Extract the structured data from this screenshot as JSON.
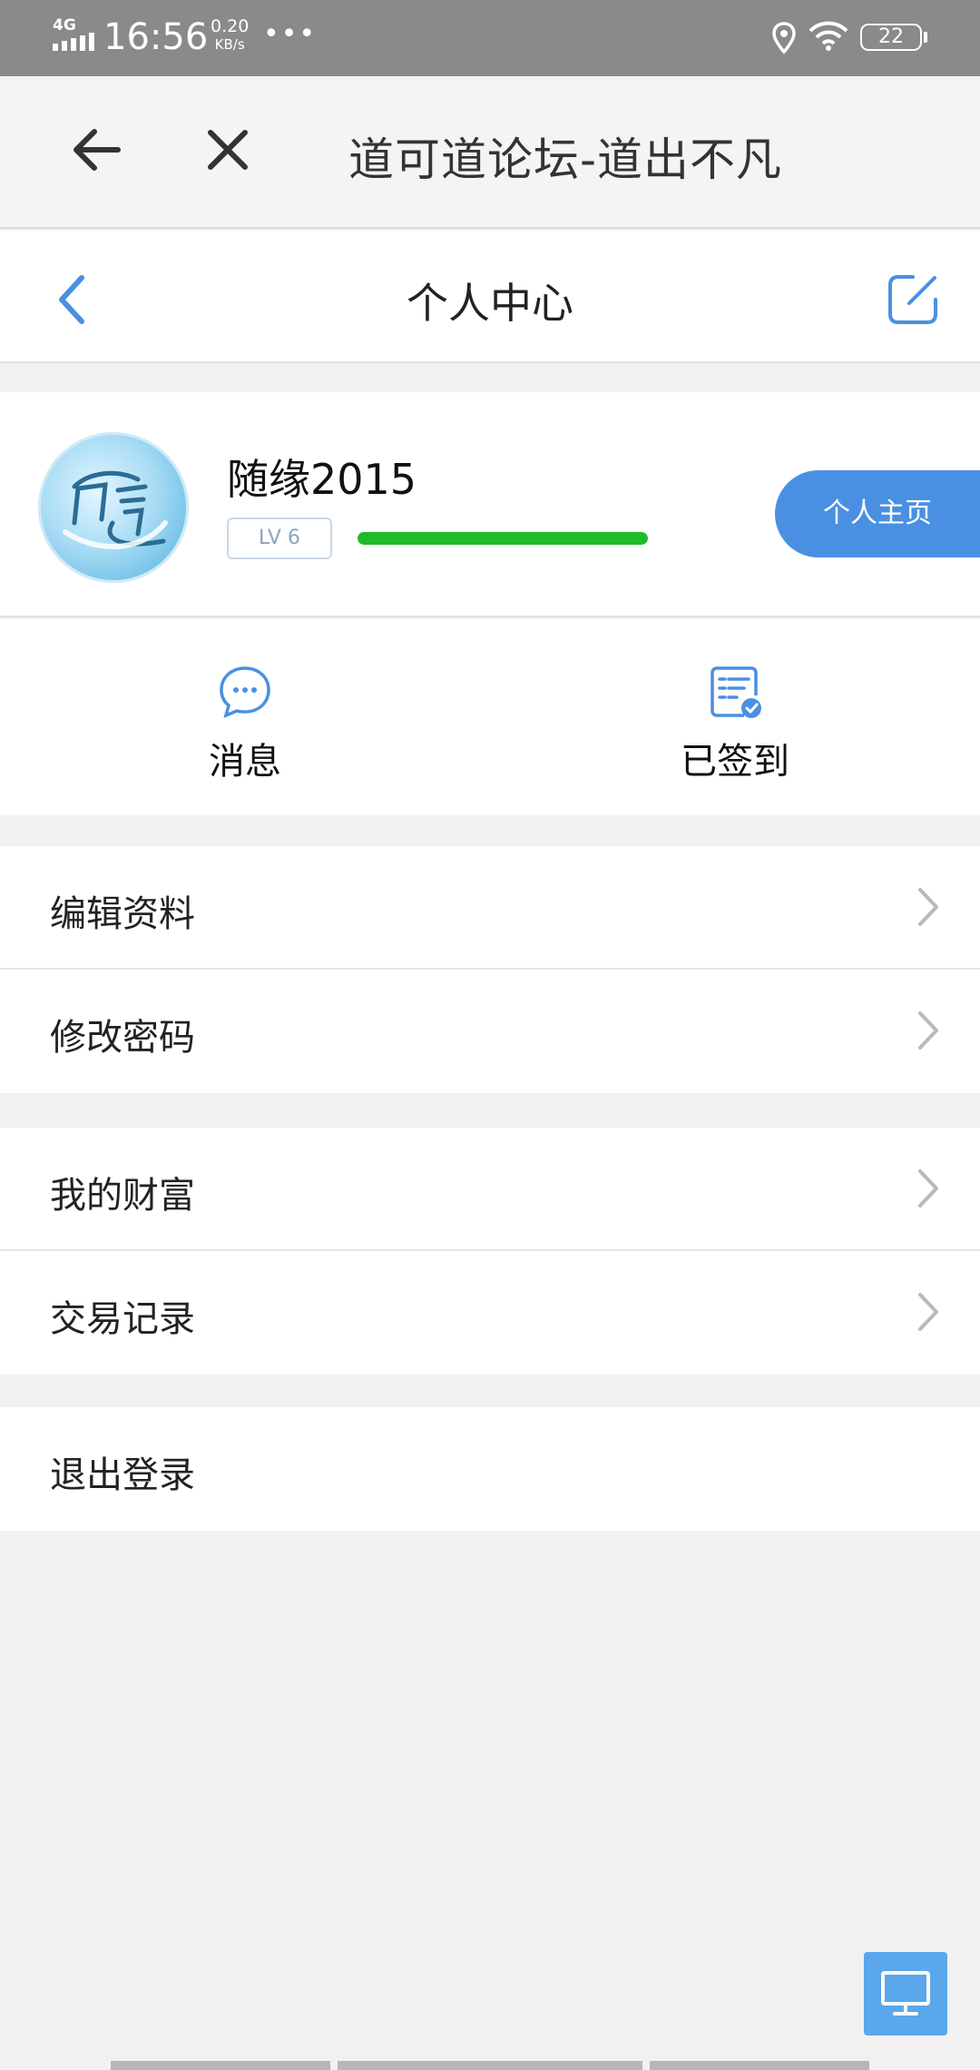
{
  "status_bar": {
    "network": "4G",
    "time": "16:56",
    "speed_value": "0.20",
    "speed_unit": "KB/s",
    "more": "•••",
    "battery": "22"
  },
  "browser": {
    "title": "道可道论坛-道出不凡"
  },
  "page": {
    "title": "个人中心"
  },
  "profile": {
    "username": "随缘2015",
    "level": "LV 6",
    "level_progress": 1.0,
    "homepage_button": "个人主页"
  },
  "quick_actions": [
    {
      "label": "消息",
      "icon": "message-icon"
    },
    {
      "label": "已签到",
      "icon": "checkin-icon"
    }
  ],
  "menu_groups": [
    {
      "items": [
        {
          "label": "编辑资料"
        },
        {
          "label": "修改密码"
        }
      ]
    },
    {
      "items": [
        {
          "label": "我的财富"
        },
        {
          "label": "交易记录"
        }
      ]
    },
    {
      "items": [
        {
          "label": "退出登录"
        }
      ]
    }
  ],
  "colors": {
    "accent": "#4a90e2",
    "progress": "#1dbb2a",
    "status_bar": "#8a8a8a",
    "background": "#f1f1f1"
  }
}
